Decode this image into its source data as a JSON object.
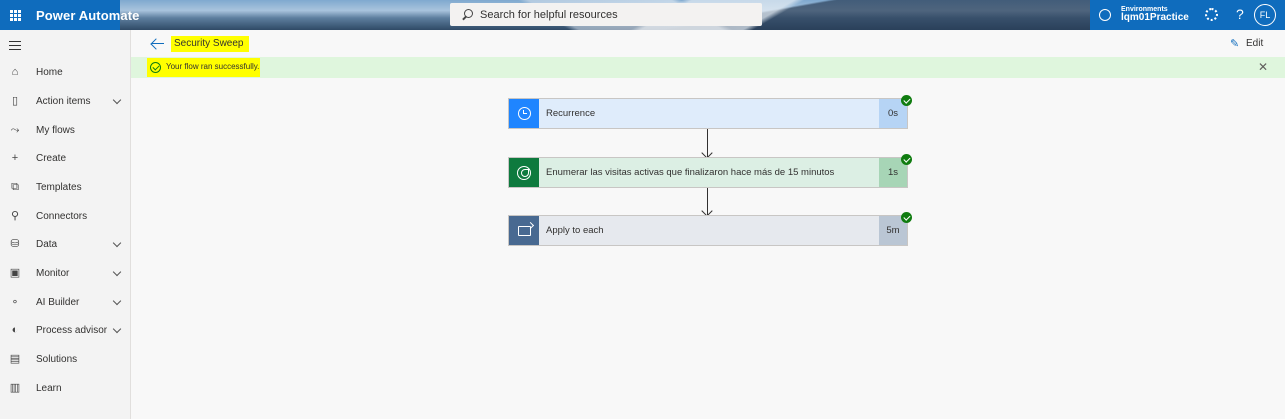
{
  "app": {
    "name": "Power Automate"
  },
  "search": {
    "placeholder": "Search for helpful resources"
  },
  "environment": {
    "label": "Environments",
    "value": "lqm01Practice"
  },
  "user": {
    "initials": "FL"
  },
  "header": {
    "title": "Security Sweep",
    "edit_label": "Edit"
  },
  "banner": {
    "message": "Your flow ran successfully."
  },
  "sidebar": {
    "items": [
      {
        "label": "Home",
        "icon": "home-icon"
      },
      {
        "label": "Action items",
        "icon": "clipboard-icon",
        "expandable": true
      },
      {
        "label": "My flows",
        "icon": "flows-icon"
      },
      {
        "label": "Create",
        "icon": "plus-icon"
      },
      {
        "label": "Templates",
        "icon": "templates-icon"
      },
      {
        "label": "Connectors",
        "icon": "connector-icon"
      },
      {
        "label": "Data",
        "icon": "database-icon",
        "expandable": true
      },
      {
        "label": "Monitor",
        "icon": "monitor-icon",
        "expandable": true
      },
      {
        "label": "AI Builder",
        "icon": "ai-builder-icon",
        "expandable": true
      },
      {
        "label": "Process advisor",
        "icon": "process-advisor-icon",
        "expandable": true
      },
      {
        "label": "Solutions",
        "icon": "solutions-icon"
      },
      {
        "label": "Learn",
        "icon": "book-icon"
      }
    ]
  },
  "steps": [
    {
      "name": "Recurrence",
      "duration": "0s",
      "status": "succeeded",
      "icon": "clock-icon",
      "color": "#1f85ff"
    },
    {
      "name": "Enumerar las visitas activas que finalizaron hace más de 15 minutos",
      "duration": "1s",
      "status": "succeeded",
      "icon": "dataverse-icon",
      "color": "#0e7a3e"
    },
    {
      "name": "Apply to each",
      "duration": "5m",
      "status": "succeeded",
      "icon": "loop-icon",
      "color": "#486991"
    }
  ],
  "colors": {
    "brand": "#0f6cbd",
    "success": "#107c10",
    "highlight": "#ffff00"
  }
}
